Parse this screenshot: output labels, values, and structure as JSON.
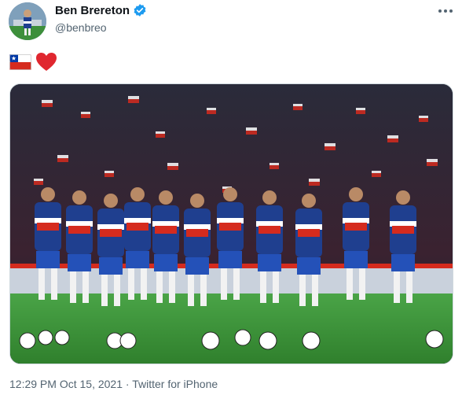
{
  "tweet": {
    "display_name": "Ben Brereton",
    "handle": "@benbreo",
    "verified": true,
    "text_emojis": [
      "chile-flag",
      "red-heart"
    ],
    "timestamp_time": "12:29 PM",
    "separator": "·",
    "timestamp_date": "Oct 15, 2021",
    "source": "Twitter for iPhone"
  },
  "icons": {
    "verified": "verified-badge-icon",
    "more": "more-options-icon"
  },
  "colors": {
    "verified_blue": "#1d9bf0",
    "secondary_text": "#536471",
    "chile_red": "#d52b1e",
    "chile_blue": "#0039a6",
    "pitch_green": "#3f9b3a"
  }
}
